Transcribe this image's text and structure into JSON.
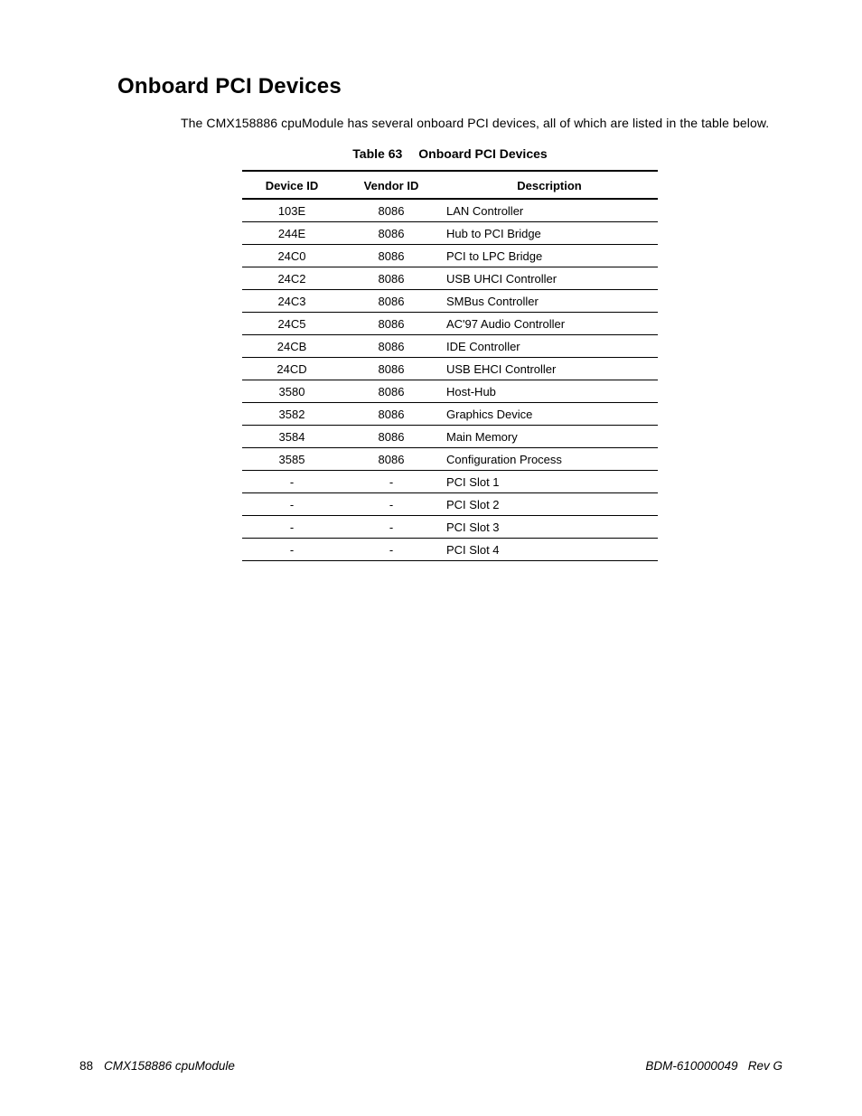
{
  "sectionTitle": "Onboard PCI Devices",
  "intro": "The CMX158886 cpuModule has several onboard PCI devices, all of which are listed in the table below.",
  "tableCaptionNum": "Table 63",
  "tableCaptionTitle": "Onboard PCI Devices",
  "headers": {
    "c1": "Device ID",
    "c2": "Vendor ID",
    "c3": "Description"
  },
  "rows": [
    {
      "c1": "103E",
      "c2": "8086",
      "c3": "LAN Controller"
    },
    {
      "c1": "244E",
      "c2": "8086",
      "c3": "Hub to PCI Bridge"
    },
    {
      "c1": "24C0",
      "c2": "8086",
      "c3": "PCI to LPC Bridge"
    },
    {
      "c1": "24C2",
      "c2": "8086",
      "c3": "USB UHCI Controller"
    },
    {
      "c1": "24C3",
      "c2": "8086",
      "c3": "SMBus Controller"
    },
    {
      "c1": "24C5",
      "c2": "8086",
      "c3": "AC'97 Audio Controller"
    },
    {
      "c1": "24CB",
      "c2": "8086",
      "c3": "IDE Controller"
    },
    {
      "c1": "24CD",
      "c2": "8086",
      "c3": "USB EHCI Controller"
    },
    {
      "c1": "3580",
      "c2": "8086",
      "c3": "Host-Hub"
    },
    {
      "c1": "3582",
      "c2": "8086",
      "c3": "Graphics Device"
    },
    {
      "c1": "3584",
      "c2": "8086",
      "c3": "Main Memory"
    },
    {
      "c1": "3585",
      "c2": "8086",
      "c3": "Configuration Process"
    },
    {
      "c1": "-",
      "c2": "-",
      "c3": "PCI Slot 1"
    },
    {
      "c1": "-",
      "c2": "-",
      "c3": "PCI Slot 2"
    },
    {
      "c1": "-",
      "c2": "-",
      "c3": "PCI Slot 3"
    },
    {
      "c1": "-",
      "c2": "-",
      "c3": "PCI Slot 4"
    }
  ],
  "footer": {
    "pageNum": "88",
    "leftText": "CMX158886 cpuModule",
    "rightDoc": "BDM-610000049",
    "rightRev": "Rev G"
  }
}
